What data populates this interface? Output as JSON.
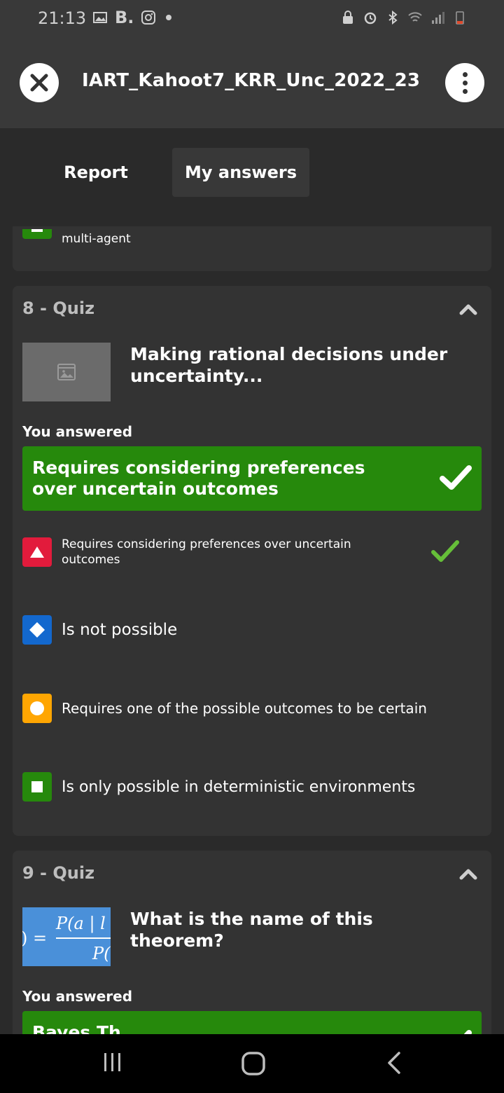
{
  "status_bar": {
    "time": "21:13",
    "left_icons": [
      "gallery-icon",
      "b-app-icon",
      "instagram-icon",
      "notification-dot"
    ],
    "right_icons": [
      "lock-icon",
      "alarm-icon",
      "bluetooth-icon",
      "wifi-icon",
      "signal-icon",
      "battery-icon"
    ],
    "b_label": "B."
  },
  "header": {
    "title": "IART_Kahoot7_KRR_Unc_2022_23"
  },
  "tabs": [
    {
      "label": "Report",
      "active": false
    },
    {
      "label": "My answers",
      "active": true
    }
  ],
  "previous_card": {
    "option_text": "multi-agent"
  },
  "questions": [
    {
      "header": "8 - Quiz",
      "question": "Making rational decisions under uncertainty...",
      "you_answered_label": "You answered",
      "answer": "Requires considering preferences over uncertain outcomes",
      "options": [
        {
          "shape": "triangle",
          "color": "#e21b3c",
          "text": "Requires considering preferences over uncertain outcomes",
          "correct": true
        },
        {
          "shape": "diamond",
          "color": "#1368ce",
          "text": "Is not possible",
          "correct": false
        },
        {
          "shape": "circle",
          "color": "#ffa602",
          "text": "Requires one of the possible outcomes to be certain",
          "correct": false
        },
        {
          "shape": "square",
          "color": "#26890c",
          "text": "Is only possible in deterministic environments",
          "correct": false
        }
      ]
    },
    {
      "header": "9 - Quiz",
      "question": "What is the name of this theorem?",
      "you_answered_label": "You answered",
      "thumb_formula_top": "P(a | l",
      "thumb_formula_bottom": "P(",
      "thumb_formula_left": ") =",
      "answer": "Bayes Th"
    }
  ],
  "colors": {
    "correct_green": "#26890c",
    "check_green": "#66bf39",
    "background": "#2a2a2a",
    "card": "#333333",
    "header": "#393939"
  },
  "navbar": [
    "recent-apps-icon",
    "home-icon",
    "back-icon"
  ]
}
